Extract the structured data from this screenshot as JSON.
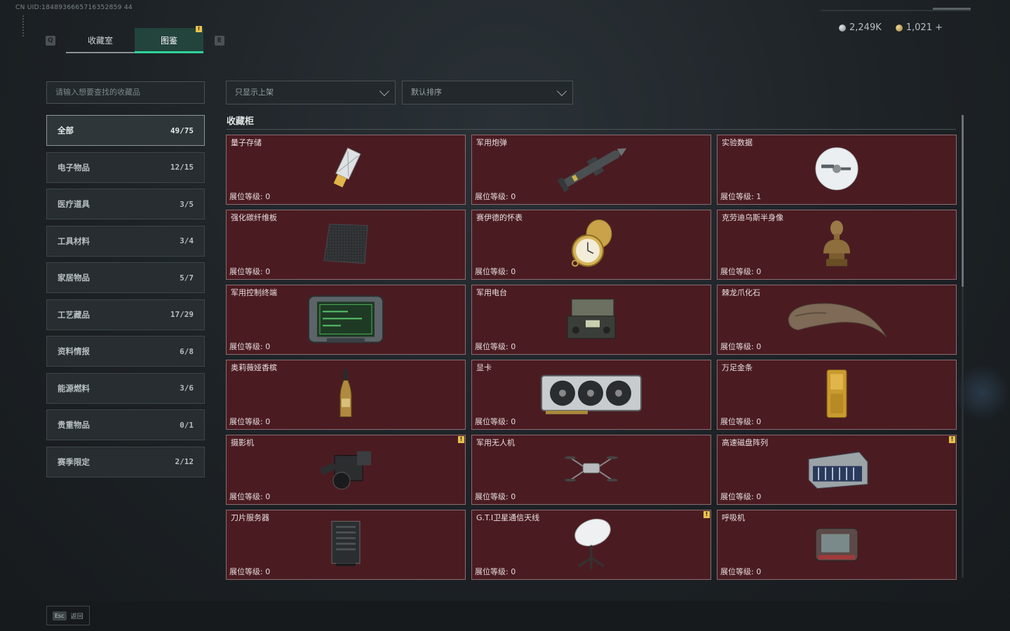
{
  "header": {
    "uid": "CN UID:1848936665716352859 44",
    "tabs": [
      {
        "label": "收藏室",
        "key": "Q"
      },
      {
        "label": "图鉴",
        "key": "E",
        "alert": "!"
      }
    ],
    "key_left": "Q",
    "key_right": "E",
    "currency": [
      {
        "value": "2,249K",
        "color": "#9aa4aa"
      },
      {
        "value": "1,021 +",
        "color": "#c8a960"
      }
    ]
  },
  "search": {
    "placeholder": "请输入想要查找的收藏品"
  },
  "filters": {
    "shelf": "只显示上架",
    "sort": "默认排序"
  },
  "categories": [
    {
      "label": "全部",
      "count": "49/75",
      "selected": true
    },
    {
      "label": "电子物品",
      "count": "12/15"
    },
    {
      "label": "医疗道具",
      "count": "3/5"
    },
    {
      "label": "工具材料",
      "count": "3/4"
    },
    {
      "label": "家居物品",
      "count": "5/7"
    },
    {
      "label": "工艺藏品",
      "count": "17/29"
    },
    {
      "label": "资料情报",
      "count": "6/8"
    },
    {
      "label": "能源燃料",
      "count": "3/6"
    },
    {
      "label": "贵重物品",
      "count": "0/1"
    },
    {
      "label": "赛季限定",
      "count": "2/12"
    }
  ],
  "section_title": "收藏柜",
  "items": [
    {
      "name": "量子存储",
      "level": "展位等级: 0",
      "icon": "usb-drive-icon"
    },
    {
      "name": "军用炮弹",
      "level": "展位等级: 0",
      "icon": "missile-icon"
    },
    {
      "name": "实验数据",
      "level": "展位等级: 1",
      "icon": "disc-icon"
    },
    {
      "name": "强化碳纤维板",
      "level": "展位等级: 0",
      "icon": "carbon-plate-icon"
    },
    {
      "name": "赛伊德的怀表",
      "level": "展位等级: 0",
      "icon": "pocket-watch-icon"
    },
    {
      "name": "克劳迪乌斯半身像",
      "level": "展位等级: 0",
      "icon": "bust-icon"
    },
    {
      "name": "军用控制终端",
      "level": "展位等级: 0",
      "icon": "control-terminal-icon"
    },
    {
      "name": "军用电台",
      "level": "展位等级: 0",
      "icon": "radio-icon"
    },
    {
      "name": "棘龙爪化石",
      "level": "展位等级: 0",
      "icon": "claw-fossil-icon"
    },
    {
      "name": "奥莉薇娅香槟",
      "level": "展位等级: 0",
      "icon": "champagne-icon"
    },
    {
      "name": "显卡",
      "level": "展位等级: 0",
      "icon": "gpu-icon"
    },
    {
      "name": "万足金条",
      "level": "展位等级: 0",
      "icon": "gold-bar-icon"
    },
    {
      "name": "摄影机",
      "level": "展位等级: 0",
      "icon": "camera-icon",
      "alert": "!"
    },
    {
      "name": "军用无人机",
      "level": "展位等级: 0",
      "icon": "drone-icon"
    },
    {
      "name": "高速磁盘阵列",
      "level": "展位等级: 0",
      "icon": "disk-array-icon",
      "alert": "!"
    },
    {
      "name": "刀片服务器",
      "level": "展位等级: 0",
      "icon": "server-icon"
    },
    {
      "name": "G.T.I卫星通信天线",
      "level": "展位等级: 0",
      "icon": "satellite-dish-icon",
      "alert": "!"
    },
    {
      "name": "呼吸机",
      "level": "展位等级: 0",
      "icon": "ventilator-icon"
    }
  ],
  "footer": {
    "esc_key": "Esc",
    "esc_label": "返回"
  }
}
